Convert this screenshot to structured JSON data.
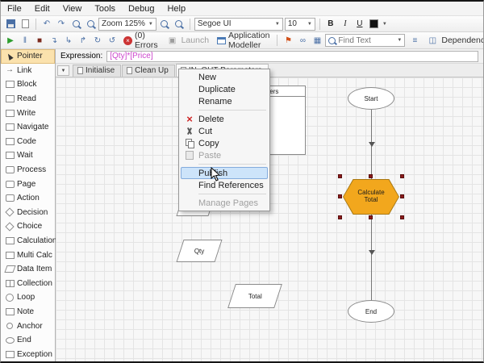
{
  "menu_bar": {
    "items": [
      {
        "name": "menu-file",
        "label": "File"
      },
      {
        "name": "menu-edit",
        "label": "Edit"
      },
      {
        "name": "menu-view",
        "label": "View"
      },
      {
        "name": "menu-tools",
        "label": "Tools"
      },
      {
        "name": "menu-debug",
        "label": "Debug"
      },
      {
        "name": "menu-help",
        "label": "Help"
      }
    ]
  },
  "toolbar_format": {
    "zoom_label": "Zoom 125%",
    "font_name": "Segoe UI",
    "font_size": "10",
    "bold": "B",
    "italic": "I",
    "underline": "U"
  },
  "toolbar_debug": {
    "errors_label": "(0) Errors",
    "launch_label": "Launch",
    "app_modeller_label": "Application Modeller",
    "find_text_placeholder": "Find Text",
    "dependencies_label": "Dependencies"
  },
  "expression": {
    "label": "Expression:",
    "value": "[Qty]*[Price]"
  },
  "sidebar": {
    "items": [
      {
        "name": "sidebar-item-pointer",
        "label": "Pointer",
        "icon": "pointer-icon",
        "state": "selected"
      },
      {
        "name": "sidebar-item-link",
        "label": "Link",
        "icon": "link-icon",
        "state": ""
      },
      {
        "name": "sidebar-item-block",
        "label": "Block",
        "icon": "block-icon",
        "state": ""
      },
      {
        "name": "sidebar-item-read",
        "label": "Read",
        "icon": "read-icon",
        "state": ""
      },
      {
        "name": "sidebar-item-write",
        "label": "Write",
        "icon": "write-icon",
        "state": ""
      },
      {
        "name": "sidebar-item-navigate",
        "label": "Navigate",
        "icon": "navigate-icon",
        "state": ""
      },
      {
        "name": "sidebar-item-code",
        "label": "Code",
        "icon": "code-icon",
        "state": ""
      },
      {
        "name": "sidebar-item-wait",
        "label": "Wait",
        "icon": "wait-icon",
        "state": ""
      },
      {
        "name": "sidebar-item-process",
        "label": "Process",
        "icon": "process-icon",
        "state": ""
      },
      {
        "name": "sidebar-item-page",
        "label": "Page",
        "icon": "page-icon",
        "state": ""
      },
      {
        "name": "sidebar-item-action",
        "label": "Action",
        "icon": "action-icon",
        "state": ""
      },
      {
        "name": "sidebar-item-decision",
        "label": "Decision",
        "icon": "decision-icon",
        "state": ""
      },
      {
        "name": "sidebar-item-choice",
        "label": "Choice",
        "icon": "choice-icon",
        "state": ""
      },
      {
        "name": "sidebar-item-calculation",
        "label": "Calculation",
        "icon": "calculation-icon",
        "state": ""
      },
      {
        "name": "sidebar-item-multi-calc",
        "label": "Multi Calc",
        "icon": "multicalc-icon",
        "state": ""
      },
      {
        "name": "sidebar-item-data-item",
        "label": "Data Item",
        "icon": "dataitem-icon",
        "state": ""
      },
      {
        "name": "sidebar-item-collection",
        "label": "Collection",
        "icon": "collection-icon",
        "state": ""
      },
      {
        "name": "sidebar-item-loop",
        "label": "Loop",
        "icon": "loop-icon",
        "state": ""
      },
      {
        "name": "sidebar-item-note",
        "label": "Note",
        "icon": "note-icon",
        "state": ""
      },
      {
        "name": "sidebar-item-anchor",
        "label": "Anchor",
        "icon": "anchor-icon",
        "state": ""
      },
      {
        "name": "sidebar-item-end",
        "label": "End",
        "icon": "end-icon",
        "state": ""
      },
      {
        "name": "sidebar-item-exception",
        "label": "Exception",
        "icon": "exception-icon",
        "state": ""
      }
    ]
  },
  "tabs": {
    "items": [
      {
        "name": "tab-initialise",
        "label": "Initialise",
        "state": ""
      },
      {
        "name": "tab-clean-up",
        "label": "Clean Up",
        "state": ""
      },
      {
        "name": "tab-in-out-parameters",
        "label": "IN_OUT Parameters",
        "state": "active"
      }
    ]
  },
  "context_menu": {
    "items": [
      {
        "name": "menu-item-new",
        "label": "New",
        "icon": "",
        "state": ""
      },
      {
        "name": "menu-item-duplicate",
        "label": "Duplicate",
        "icon": "",
        "state": ""
      },
      {
        "name": "menu-item-rename",
        "label": "Rename",
        "icon": "",
        "state": ""
      },
      {
        "name": "menu-separator",
        "label": "",
        "icon": "",
        "state": "separator"
      },
      {
        "name": "menu-item-delete",
        "label": "Delete",
        "icon": "delete-icon",
        "state": ""
      },
      {
        "name": "menu-item-cut",
        "label": "Cut",
        "icon": "cut-icon",
        "state": ""
      },
      {
        "name": "menu-item-copy",
        "label": "Copy",
        "icon": "copy-icon",
        "state": ""
      },
      {
        "name": "menu-item-paste",
        "label": "Paste",
        "icon": "paste-icon",
        "state": "disabled"
      },
      {
        "name": "menu-separator",
        "label": "",
        "icon": "",
        "state": "separator"
      },
      {
        "name": "menu-item-publish",
        "label": "Publish",
        "icon": "",
        "state": "highlighted"
      },
      {
        "name": "menu-item-find-references",
        "label": "Find References",
        "icon": "",
        "state": ""
      },
      {
        "name": "menu-separator",
        "label": "",
        "icon": "",
        "state": "separator"
      },
      {
        "name": "menu-item-manage-pages",
        "label": "Manage Pages",
        "icon": "",
        "state": "disabled"
      }
    ]
  },
  "canvas": {
    "table_title": "IN_OUT Parameters",
    "start_label": "Start",
    "calc_label": "Calculate Total",
    "end_label": "End",
    "qty_label": "Qty",
    "total_label": "Total"
  },
  "colors": {
    "stage_fill": "#F2A71D",
    "stage_border": "#A87813",
    "selection_handle": "#8B1A1A",
    "menu_highlight": "#CDE4FA",
    "expression_text": "#CC44CC",
    "flag": "#D2521B",
    "play": "#2E9E2E"
  }
}
